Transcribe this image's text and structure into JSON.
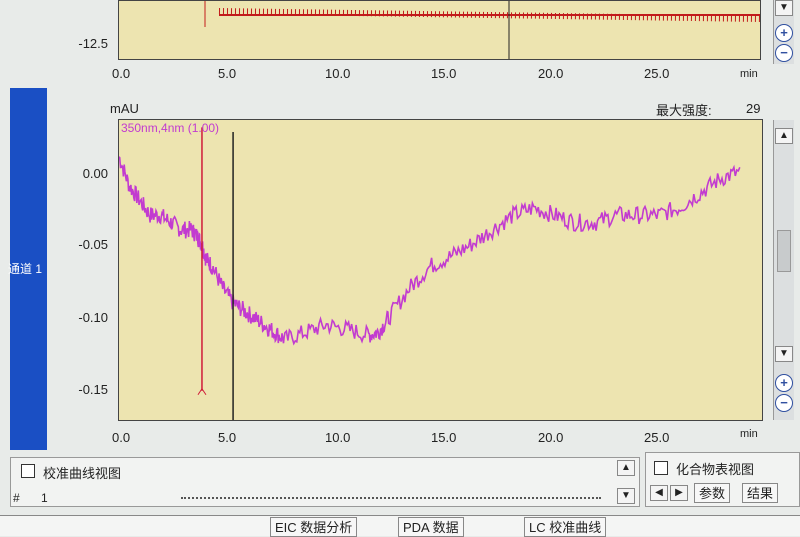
{
  "top_chart": {
    "y_tick": "-12.5",
    "x_ticks": [
      "0.0",
      "5.0",
      "10.0",
      "15.0",
      "20.0",
      "25.0"
    ],
    "x_unit": "min"
  },
  "sidebar": {
    "label": "通道 1"
  },
  "header": {
    "y_unit": "mAU",
    "max_intensity_label": "最大强度:",
    "max_intensity_value": "29"
  },
  "chart_data": {
    "type": "line",
    "title": "",
    "series": [
      {
        "name": "350nm,4nm (1.00)",
        "color": "#c23bd0"
      }
    ],
    "x": [
      0.0,
      0.5,
      1.0,
      1.5,
      2.0,
      2.5,
      3.0,
      3.5,
      3.8,
      4.0,
      4.2,
      4.5,
      5.0,
      5.5,
      6.0,
      6.5,
      7.0,
      7.5,
      8.0,
      9.0,
      10.0,
      11.0,
      12.0,
      12.5,
      13.0,
      14.0,
      15.0,
      16.0,
      17.0,
      18.0,
      19.0,
      20.0,
      21.0,
      22.0,
      23.0,
      24.0,
      25.0,
      26.0,
      27.0,
      28.0,
      29.0,
      30.0
    ],
    "y": [
      0.01,
      -0.01,
      -0.02,
      -0.03,
      -0.03,
      -0.035,
      -0.04,
      -0.04,
      -0.045,
      -0.05,
      -0.06,
      -0.065,
      -0.08,
      -0.09,
      -0.095,
      -0.1,
      -0.105,
      -0.11,
      -0.115,
      -0.11,
      -0.105,
      -0.108,
      -0.112,
      -0.11,
      -0.1,
      -0.08,
      -0.065,
      -0.058,
      -0.05,
      -0.04,
      -0.03,
      -0.025,
      -0.03,
      -0.035,
      -0.035,
      -0.03,
      -0.03,
      -0.03,
      -0.025,
      -0.015,
      -0.005,
      0.0
    ],
    "spike": {
      "x": 4.0,
      "y_min": -0.15,
      "y_max": 0.03,
      "color": "#d01c38"
    },
    "marker_x": 5.5,
    "xlim": [
      0,
      31
    ],
    "ylim": [
      -0.17,
      0.035
    ],
    "x_ticks": [
      "0.0",
      "5.0",
      "10.0",
      "15.0",
      "20.0",
      "25.0"
    ],
    "y_ticks": [
      "0.00",
      "-0.05",
      "-0.10",
      "-0.15"
    ],
    "x_unit": "min",
    "grid": false
  },
  "bottom_left": {
    "title": "校准曲线视图",
    "row_label": "#",
    "row_value": "1"
  },
  "bottom_right": {
    "title": "化合物表视图",
    "tabs": [
      "参数",
      "结果"
    ]
  },
  "taskbar": {
    "items": [
      "数据分析",
      "PDA 数据",
      "校准曲线"
    ],
    "tab_prefixes": [
      "EIC",
      "LC"
    ]
  },
  "colors": {
    "plot_bg": "#ede4b0",
    "trace": "#c23bd0",
    "spike": "#d01c38",
    "sidebar": "#1a4fc4"
  }
}
